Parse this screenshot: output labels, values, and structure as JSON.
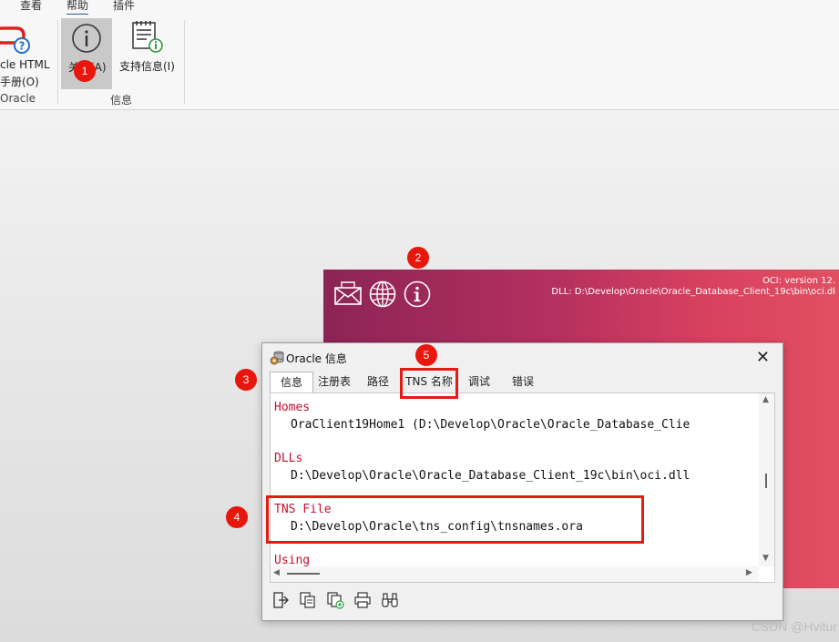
{
  "menubar": {
    "items": [
      "查看",
      "帮助",
      "插件"
    ],
    "active": "帮助"
  },
  "ribbon": {
    "oracle_html_manual": {
      "line1": "cle HTML",
      "line2": "手册(O)",
      "group": "Oracle"
    },
    "about": {
      "label": "关于(A)"
    },
    "support_info": {
      "label": "支持信息(I)"
    },
    "info_group": "信息"
  },
  "splash": {
    "oci_version": "OCI: version 12.",
    "dll": "DLL: D:\\Develop\\Oracle\\Oracle_Database_Client_19c\\bin\\oci.dl"
  },
  "dialog": {
    "title": "Oracle 信息",
    "tabs": [
      "信息",
      "注册表",
      "路径",
      "TNS 名称",
      "调试",
      "错误"
    ],
    "selected_tab": "信息",
    "content": {
      "homes_header": "Homes",
      "homes_value": "OraClient19Home1  (D:\\Develop\\Oracle\\Oracle_Database_Clie",
      "dlls_header": "DLLs",
      "dlls_value": "D:\\Develop\\Oracle\\Oracle_Database_Client_19c\\bin\\oci.dll",
      "tns_header": "TNS File",
      "tns_value": "D:\\Develop\\Oracle\\tns_config\\tnsnames.ora",
      "using_header": "Using"
    }
  },
  "badges": [
    "1",
    "2",
    "3",
    "4",
    "5"
  ],
  "watermark": "CSDN @Hvitur",
  "colors": {
    "accent_red": "#e41b13",
    "header_red": "#c8102e",
    "splash_left": "#8c2456",
    "splash_right": "#e05062"
  }
}
